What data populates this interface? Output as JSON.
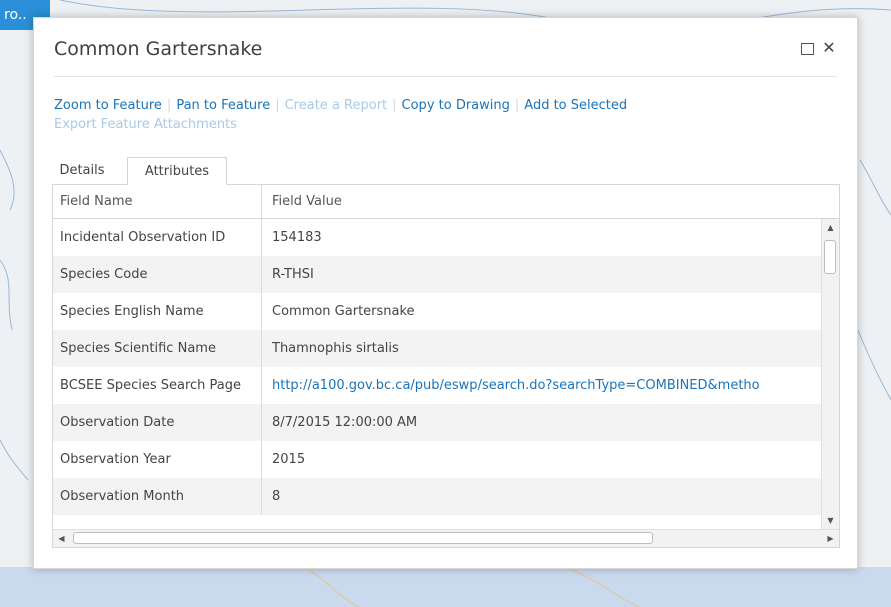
{
  "map_chip": {
    "label": "ro.."
  },
  "popup": {
    "title": "Common Gartersnake",
    "actions_row1": [
      {
        "label": "Zoom to Feature",
        "enabled": true
      },
      {
        "label": "Pan to Feature",
        "enabled": true
      },
      {
        "label": "Create a Report",
        "enabled": false
      },
      {
        "label": "Copy to Drawing",
        "enabled": true
      },
      {
        "label": "Add to Selected",
        "enabled": true
      }
    ],
    "actions_row2": [
      {
        "label": "Export Feature Attachments",
        "enabled": false
      }
    ]
  },
  "tabs": [
    {
      "label": "Details",
      "active": false
    },
    {
      "label": "Attributes",
      "active": true
    }
  ],
  "grid": {
    "headers": {
      "name": "Field Name",
      "value": "Field Value"
    },
    "rows": [
      {
        "name": "Incidental Observation ID",
        "value": "154183"
      },
      {
        "name": "Species Code",
        "value": "R-THSI"
      },
      {
        "name": "Species English Name",
        "value": "Common Gartersnake"
      },
      {
        "name": "Species Scientific Name",
        "value": "Thamnophis sirtalis"
      },
      {
        "name": "BCSEE Species Search Page",
        "value": "http://a100.gov.bc.ca/pub/eswp/search.do?searchType=COMBINED&metho",
        "link": true
      },
      {
        "name": "Observation Date",
        "value": "8/7/2015 12:00:00 AM"
      },
      {
        "name": "Observation Year",
        "value": "2015"
      },
      {
        "name": "Observation Month",
        "value": "8"
      }
    ]
  },
  "colors": {
    "link": "#1a74bb",
    "link_disabled": "#a9c9e6",
    "chip": "#2a8fd8"
  },
  "icons": {
    "maximize": "maximize-icon",
    "close": "close-icon"
  }
}
